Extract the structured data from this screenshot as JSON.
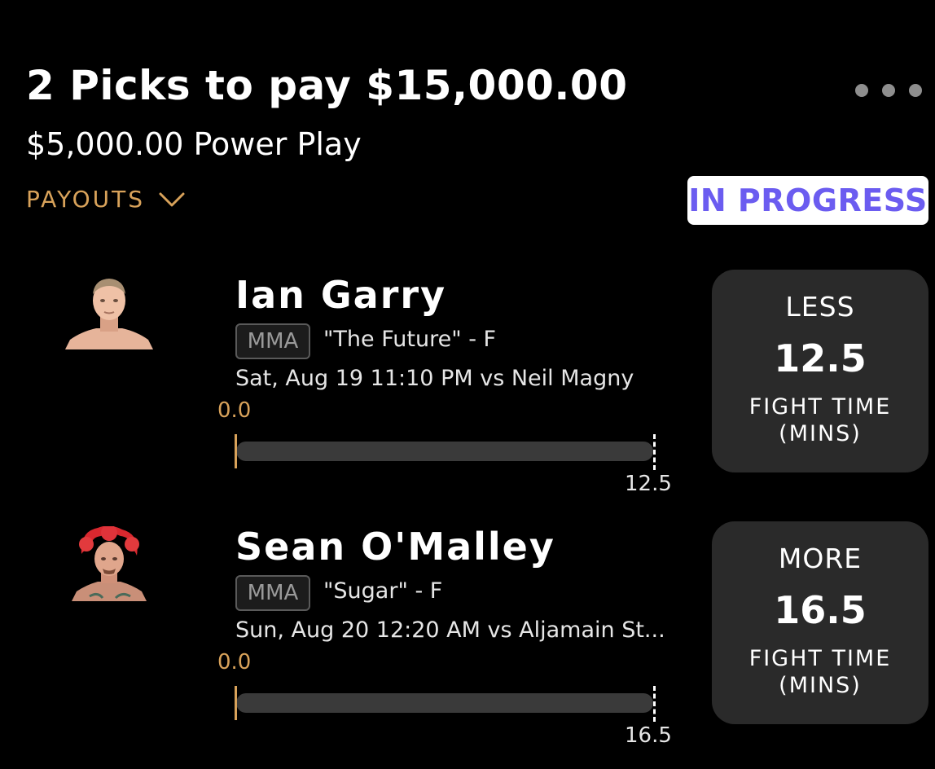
{
  "header": {
    "title": "2 Picks to pay $15,000.00",
    "subtitle": "$5,000.00 Power Play",
    "payouts_label": "PAYOUTS",
    "status": "IN PROGRESS",
    "more_icon": "more-horizontal-icon",
    "payouts_icon": "chevron-down-icon"
  },
  "colors": {
    "accent": "#d8a25a",
    "status_text": "#6b5cf0",
    "card_bg": "#2a2a2a",
    "track_bg": "#3a3a3a"
  },
  "picks": [
    {
      "player": "Ian Garry",
      "league": "MMA",
      "nickname": "\"The Future\" - F",
      "game_info": "Sat, Aug 19 11:10 PM  vs Neil Magny",
      "current": "0.0",
      "target": "12.5",
      "progress_fraction": 0.0,
      "direction": "LESS",
      "line": "12.5",
      "stat_line1": "FIGHT TIME",
      "stat_line2": "(MINS)"
    },
    {
      "player": "Sean O'Malley",
      "league": "MMA",
      "nickname": "\"Sugar\" - F",
      "game_info": "Sun, Aug 20 12:20 AM  vs Aljamain St...",
      "current": "0.0",
      "target": "16.5",
      "progress_fraction": 0.0,
      "direction": "MORE",
      "line": "16.5",
      "stat_line1": "FIGHT TIME",
      "stat_line2": "(MINS)"
    }
  ]
}
